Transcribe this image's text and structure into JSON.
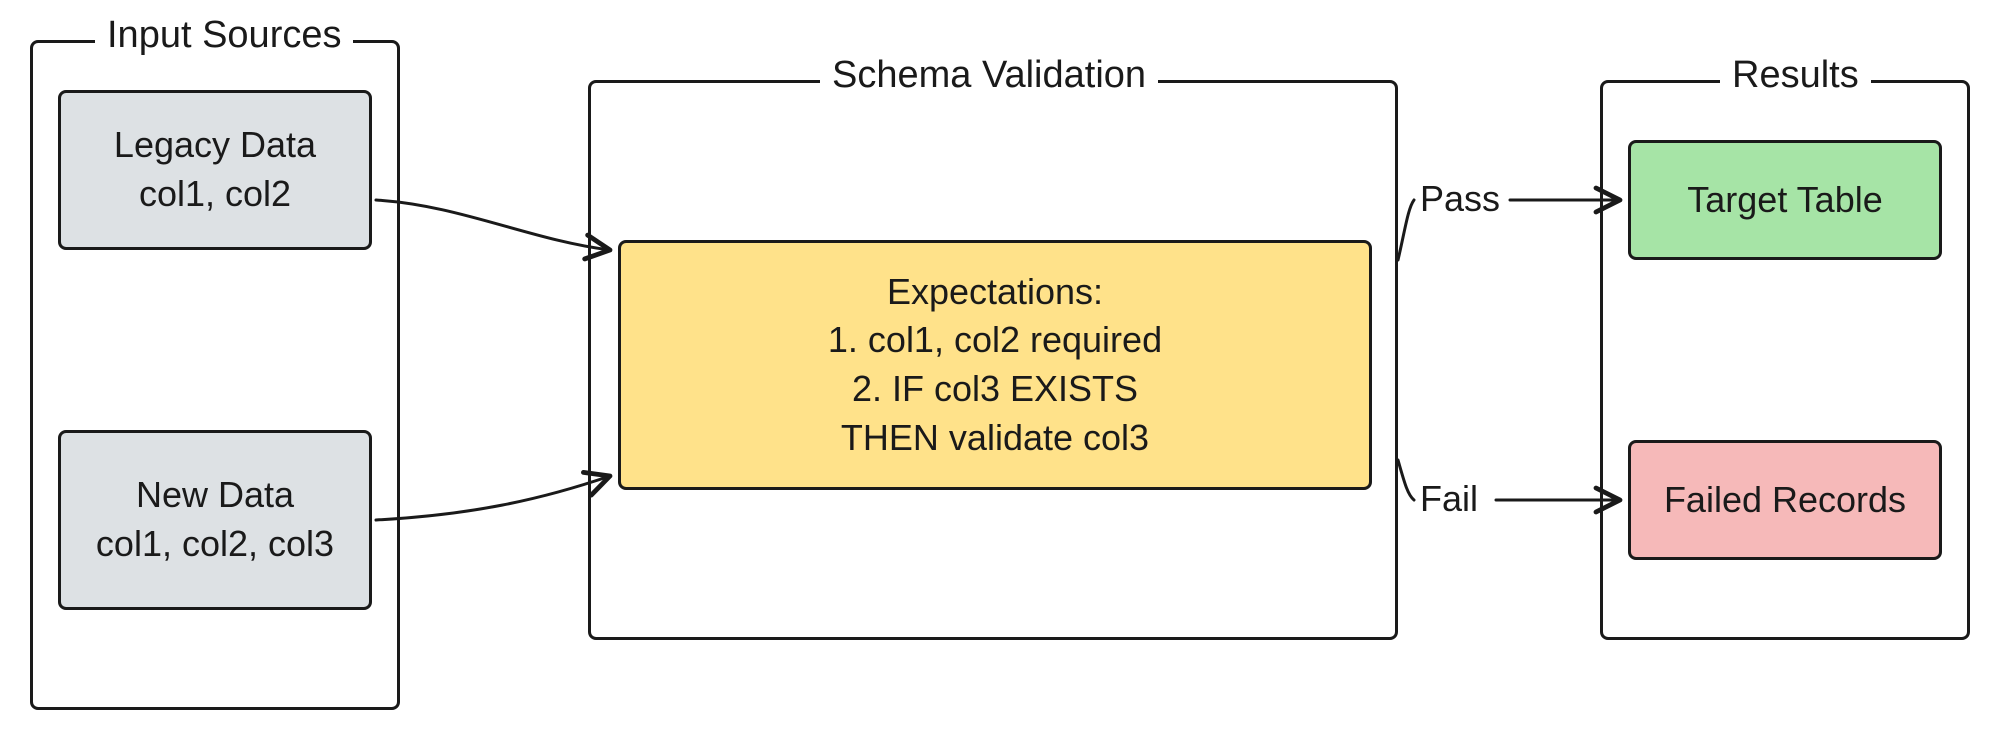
{
  "diagram": {
    "groups": {
      "input": {
        "title": "Input Sources"
      },
      "schema": {
        "title": "Schema Validation"
      },
      "results": {
        "title": "Results"
      }
    },
    "nodes": {
      "legacy": {
        "line1": "Legacy Data",
        "line2": "col1, col2"
      },
      "newdata": {
        "line1": "New Data",
        "line2": "col1, col2, col3"
      },
      "expectations": {
        "line1": "Expectations:",
        "line2": "1. col1, col2 required",
        "line3": "2. IF col3 EXISTS",
        "line4": "THEN validate col3"
      },
      "target": {
        "label": "Target Table"
      },
      "failed": {
        "label": "Failed Records"
      }
    },
    "edges": {
      "pass": {
        "label": "Pass"
      },
      "fail": {
        "label": "Fail"
      }
    }
  }
}
